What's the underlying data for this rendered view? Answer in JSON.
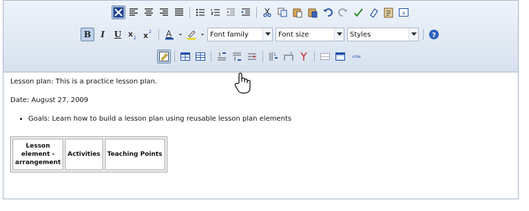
{
  "toolbar": {
    "row1": {
      "icons": [
        "select-all-icon",
        "align-left-icon",
        "align-center-icon",
        "align-right-icon",
        "align-justify-icon",
        "bullet-list-icon",
        "numbered-list-icon",
        "outdent-icon",
        "indent-icon",
        "cut-icon",
        "copy-icon",
        "paste-icon",
        "paste-word-icon",
        "undo-icon",
        "redo-icon",
        "spellcheck-icon",
        "eraser-icon",
        "paste-text-icon",
        "view-source-icon"
      ]
    },
    "row2": {
      "bold_label": "B",
      "italic_label": "I",
      "underline_label": "U",
      "font_family": "Font family",
      "font_size": "Font size",
      "styles": "Styles"
    },
    "row3": {
      "icons": [
        "edit-lesson-icon",
        "table-icon",
        "table-props-icon",
        "insert-row-before-icon",
        "insert-row-after-icon",
        "delete-row-icon",
        "insert-col-icon",
        "merge-cells-icon",
        "split-cells-icon",
        "hr-icon",
        "image-icon",
        "html-icon"
      ],
      "html_label": "HTML"
    }
  },
  "content": {
    "lesson_plan": "Lesson plan: This is a practice lesson plan.",
    "date": "Date: August 27, 2009",
    "goals": "Goals: Learn how to build a lesson plan using reusable lesson plan elements",
    "table_headers": [
      "Lesson element - arrangement",
      "Activities",
      "Teaching Points"
    ]
  },
  "colors": {
    "toolbar_top": "#eef3fa",
    "toolbar_bottom": "#d7e1ee",
    "border": "#a7b6cb",
    "accent": "#1f4fa8"
  }
}
